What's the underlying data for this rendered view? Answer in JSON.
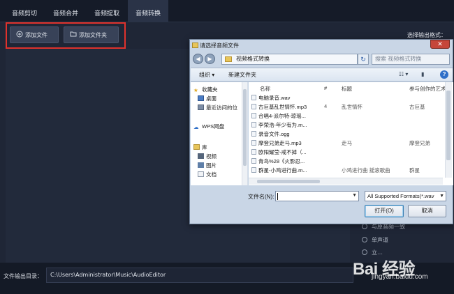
{
  "app": {
    "tabs": [
      {
        "label": "音频剪切"
      },
      {
        "label": "音频合并"
      },
      {
        "label": "音频提取"
      },
      {
        "label": "音频转换"
      }
    ],
    "add_file_label": "添加文件",
    "add_folder_label": "添加文件夹",
    "output_format_label": "选择输出格式：",
    "radio_options": [
      {
        "label": "与原音频一致"
      },
      {
        "label": "单声道"
      },
      {
        "label": "立…"
      }
    ],
    "output_dir_label": "文件输出目录：",
    "output_dir_value": "C:\\Users\\Administrator\\Music\\AudioEditor"
  },
  "dialog": {
    "title": "请选择音频文件",
    "close_label": "✕",
    "address": "视频格式转换",
    "search_placeholder": "搜索 视频格式转换",
    "organize_label": "组织 ▾",
    "new_folder_label": "新建文件夹",
    "nav_items": [
      {
        "label": "收藏夹"
      },
      {
        "label": "桌面"
      },
      {
        "label": "最近访问的位"
      },
      {
        "label": "WPS网盘"
      },
      {
        "label": "库"
      },
      {
        "label": "视频"
      },
      {
        "label": "图片"
      },
      {
        "label": "文档"
      }
    ],
    "columns": {
      "name": "名称",
      "num": "#",
      "title": "标题",
      "artist": "参与创作的艺术"
    },
    "files": [
      {
        "name": "电脑录音.wav",
        "num": "",
        "title": "",
        "artist": ""
      },
      {
        "name": "古巨基乱世情怀.mp3",
        "num": "4",
        "title": "乱世情怀",
        "artist": "古巨基"
      },
      {
        "name": "合唱4-派尔特-琼瑶...",
        "num": "",
        "title": "",
        "artist": ""
      },
      {
        "name": "李荣浩-年少有为.m...",
        "num": "",
        "title": "",
        "artist": ""
      },
      {
        "name": "录音文件.ogg",
        "num": "",
        "title": "",
        "artist": ""
      },
      {
        "name": "摩登兄弟走马.mp3",
        "num": "",
        "title": "走马",
        "artist": "摩登兄弟"
      },
      {
        "name": "欧阳耀莹-戒不掉（...",
        "num": "",
        "title": "",
        "artist": ""
      },
      {
        "name": "青鸟%28《火影忍...",
        "num": "",
        "title": "",
        "artist": ""
      },
      {
        "name": "群星-小鸡进行曲.m...",
        "num": "",
        "title": "小鸡进行曲 摇滚歌曲",
        "artist": "群星"
      }
    ],
    "filename_label": "文件名(N):",
    "filename_value": "",
    "filter_value": "All Supported Formats(*.wav",
    "open_label": "打开(O)",
    "cancel_label": "取消"
  },
  "watermark": {
    "text": "Bai 经验",
    "url": "jingyan.baidu.com"
  },
  "colors": {
    "highlight_box": "#e0322c",
    "app_bg": "#1f2636",
    "dialog_bg": "#c9d6e6"
  }
}
